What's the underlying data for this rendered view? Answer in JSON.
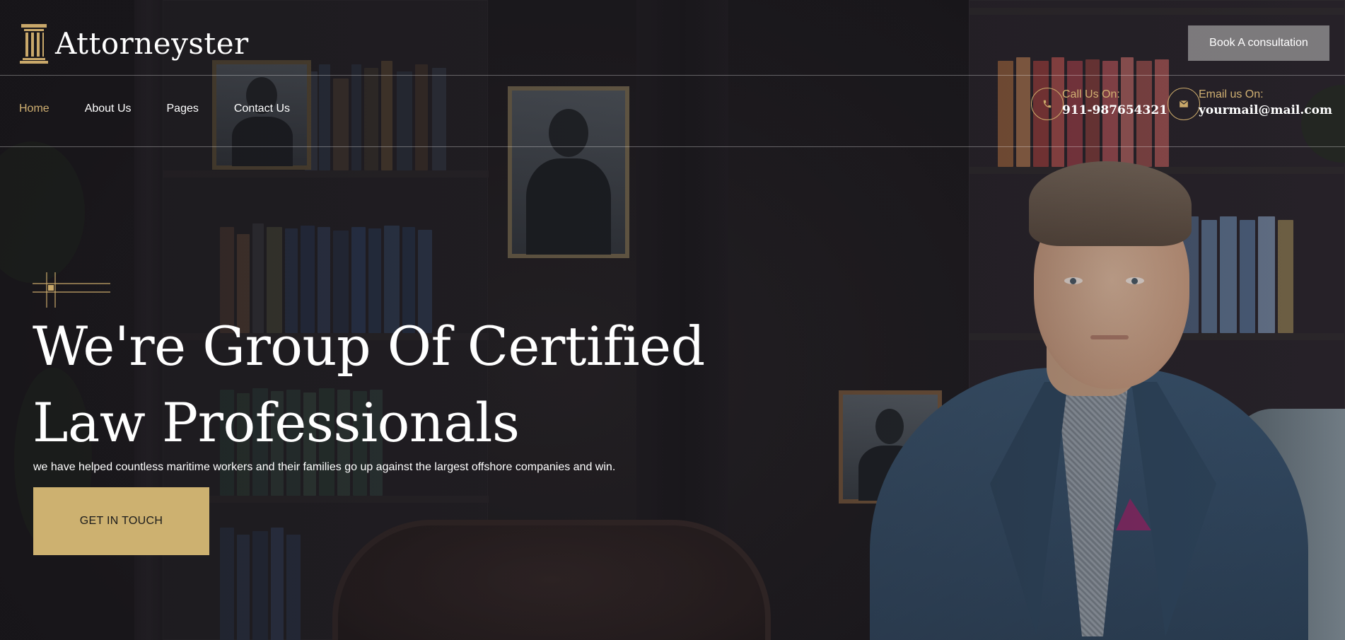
{
  "brand": {
    "name": "Attorneyster",
    "logo_icon": "pillar-icon",
    "accent_color": "#d0b072"
  },
  "header": {
    "cta_label": "Book A consultation"
  },
  "nav": {
    "items": [
      {
        "label": "Home",
        "active": true
      },
      {
        "label": "About Us",
        "active": false
      },
      {
        "label": "Pages",
        "active": false
      },
      {
        "label": "Contact Us",
        "active": false
      }
    ]
  },
  "contact": {
    "phone": {
      "label": "Call Us On:",
      "value": "911-987654321",
      "icon": "phone-icon"
    },
    "email": {
      "label": "Email us On:",
      "value": "yourmail@mail.com",
      "icon": "mail-icon"
    }
  },
  "hero": {
    "headline_line1": "We're Group Of Certified",
    "headline_line2": "Law Professionals",
    "subtext": "we have helped countless maritime workers and their families go up against the largest offshore companies and win.",
    "cta_label": "GET IN TOUCH",
    "cta_color": "#cdb170"
  }
}
